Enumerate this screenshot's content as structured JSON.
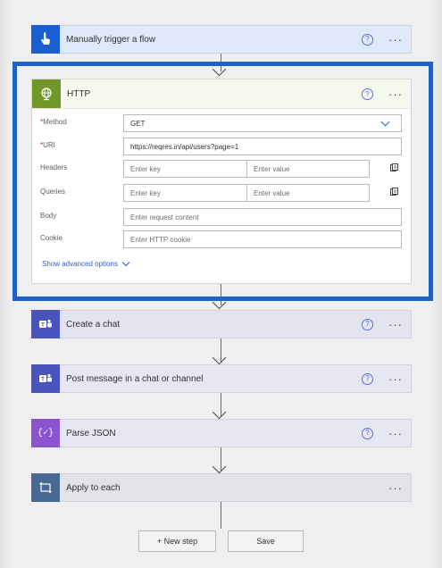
{
  "steps": [
    {
      "title": "Manually trigger a flow",
      "icon": "hand-pointer-icon",
      "color": "#1a5fd1"
    },
    {
      "title": "HTTP",
      "icon": "globe-icon",
      "color": "#709727"
    },
    {
      "title": "Create a chat",
      "icon": "teams-icon",
      "color": "#4b53bc"
    },
    {
      "title": "Post message in a chat or channel",
      "icon": "teams-icon",
      "color": "#4b53bc"
    },
    {
      "title": "Parse JSON",
      "icon": "braces-icon",
      "color": "#8b53ce"
    },
    {
      "title": "Apply to each",
      "icon": "loop-icon",
      "color": "#486991"
    }
  ],
  "http": {
    "method_label": "Method",
    "method_value": "GET",
    "uri_label": "URI",
    "uri_value": "https://reqres.in/api/users?page=1",
    "headers_label": "Headers",
    "headers_key_placeholder": "Enter key",
    "headers_value_placeholder": "Enter value",
    "queries_label": "Queries",
    "queries_key_placeholder": "Enter key",
    "queries_value_placeholder": "Enter value",
    "body_label": "Body",
    "body_placeholder": "Enter request content",
    "cookie_label": "Cookie",
    "cookie_placeholder": "Enter HTTP cookie",
    "advanced_link": "Show advanced options",
    "required_marker": "*"
  },
  "footer": {
    "new_step": "+ New step",
    "save": "Save"
  },
  "help_glyph": "?",
  "more_glyph": "···",
  "highlight_color": "#1f62c5"
}
